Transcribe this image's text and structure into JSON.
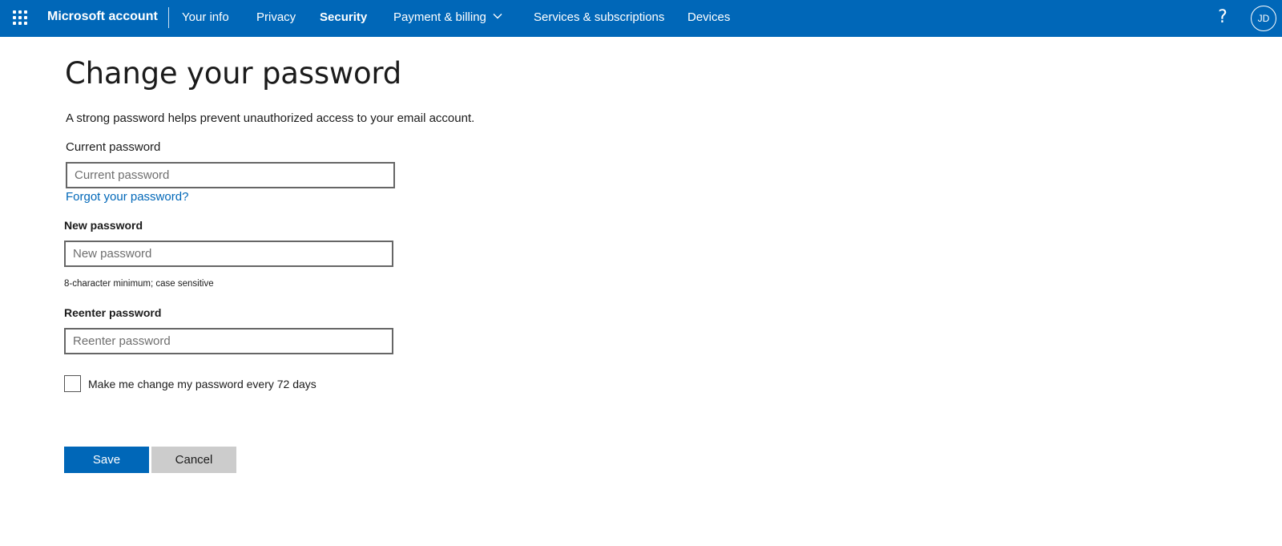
{
  "header": {
    "brand": "Microsoft account",
    "nav": [
      {
        "label": "Your info",
        "active": false
      },
      {
        "label": "Privacy",
        "active": false
      },
      {
        "label": "Security",
        "active": true
      },
      {
        "label": "Payment & billing",
        "active": false,
        "has_dropdown": true
      },
      {
        "label": "Services & subscriptions",
        "active": false
      },
      {
        "label": "Devices",
        "active": false
      }
    ],
    "help_symbol": "?",
    "avatar_initials": "JD",
    "icons": [
      "app-launcher-icon",
      "chevron-down-icon",
      "help-icon"
    ],
    "background_color": "#0067b8"
  },
  "main": {
    "title": "Change your password",
    "intro": "A strong password helps prevent unauthorized access to your email account.",
    "current_password": {
      "label": "Current password",
      "placeholder": "Current password",
      "value": ""
    },
    "forgot_link": "Forgot your password?",
    "new_password": {
      "label": "New password",
      "placeholder": "New password",
      "value": "",
      "hint": "8-character minimum; case sensitive"
    },
    "reenter_password": {
      "label": "Reenter password",
      "placeholder": "Reenter password",
      "value": ""
    },
    "expire_checkbox": {
      "label": "Make me change my password every 72 days",
      "checked": false
    },
    "save_label": "Save",
    "cancel_label": "Cancel",
    "accent_color": "#0067b8"
  }
}
